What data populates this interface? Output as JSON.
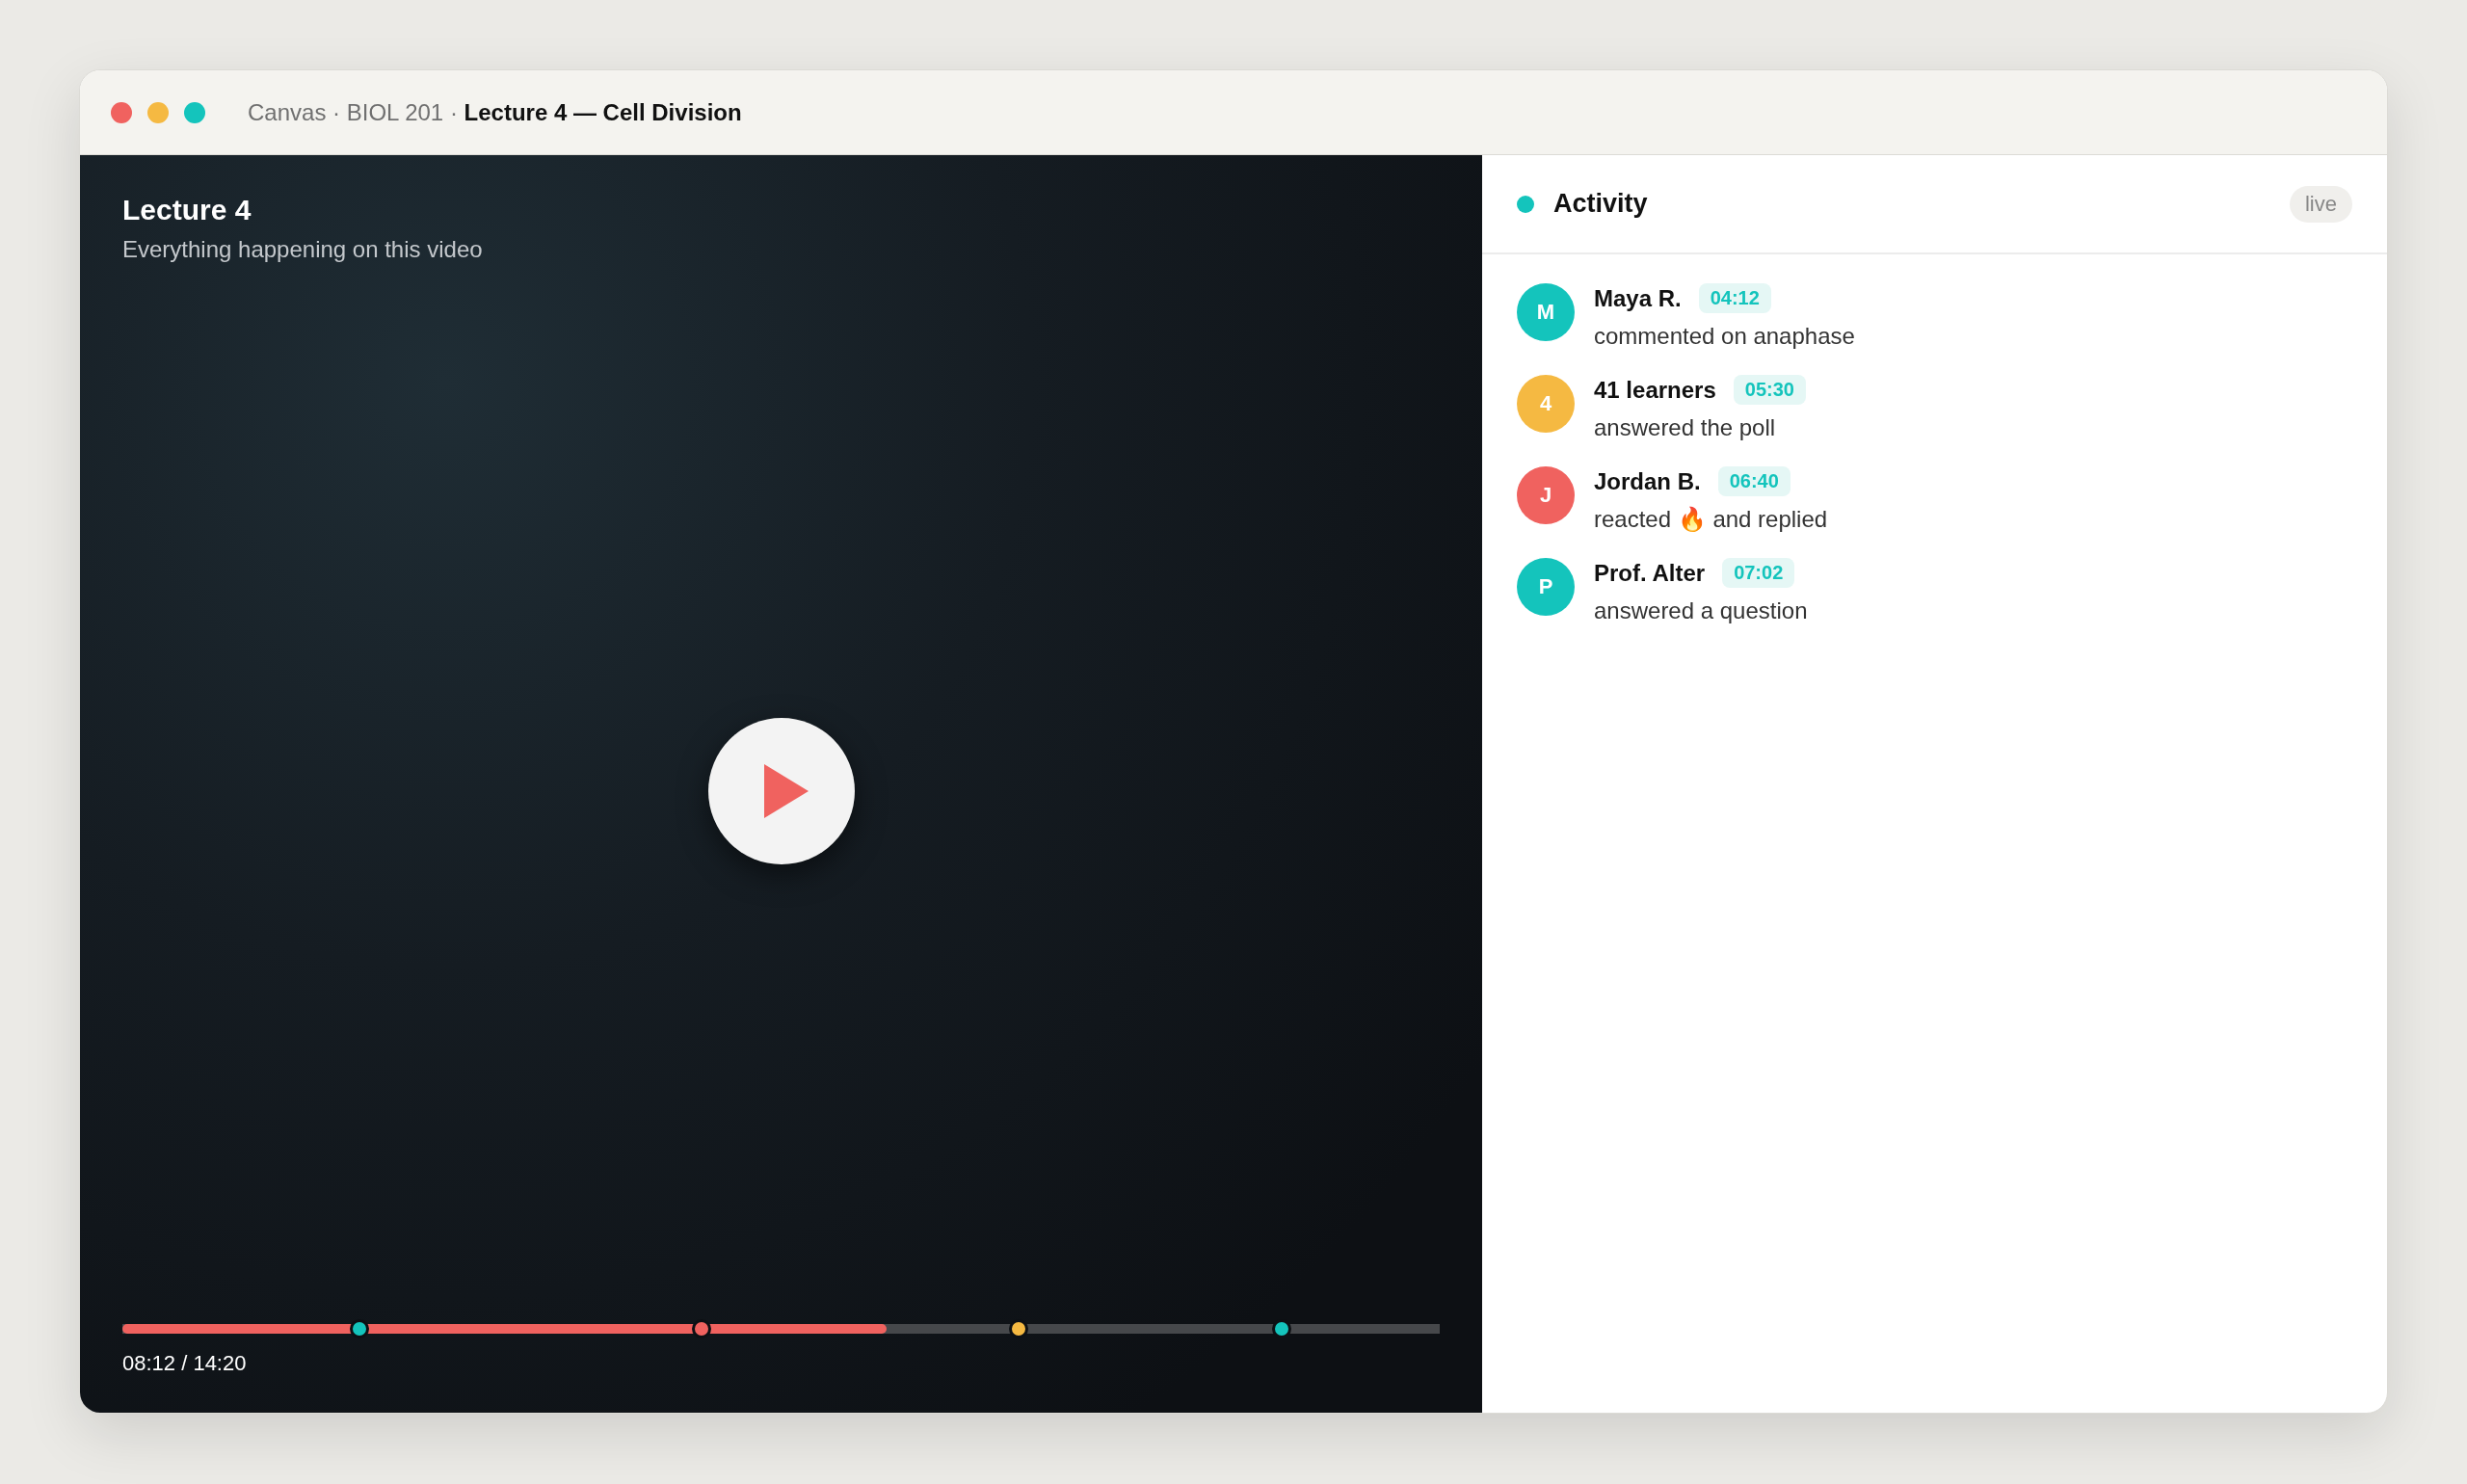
{
  "window": {
    "breadcrumb": "Canvas · BIOL 201 · ",
    "title": "Lecture 4 — Cell Division"
  },
  "video": {
    "title": "Lecture 4",
    "subtitle": "Everything happening on this video",
    "playing": false,
    "progress": {
      "level": 0.58
    },
    "time": "08:12 / 14:20",
    "markers": [
      {
        "level": 0.18,
        "color": "#14c4bc"
      },
      {
        "level": 0.44,
        "color": "#f0625f"
      },
      {
        "level": 0.68,
        "color": "#f5b942"
      },
      {
        "level": 0.88,
        "color": "#14c4bc"
      }
    ]
  },
  "activity": {
    "title": "Activity",
    "badge": "live",
    "items": [
      {
        "initial": "M",
        "color": "#14c4bc",
        "name": "Maya R.",
        "time": "04:12",
        "text": "commented on anaphase"
      },
      {
        "initial": "4",
        "color": "#f5b942",
        "name": "41 learners",
        "time": "05:30",
        "text": "answered the poll"
      },
      {
        "initial": "J",
        "color": "#f0625f",
        "name": "Jordan B.",
        "time": "06:40",
        "text": "reacted 🔥 and replied"
      },
      {
        "initial": "P",
        "color": "#14c4bc",
        "name": "Prof. Alter",
        "time": "07:02",
        "text": "answered a question"
      }
    ]
  }
}
